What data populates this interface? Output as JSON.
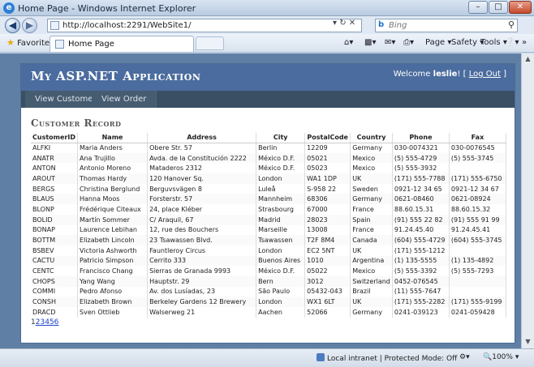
{
  "window": {
    "title": "Home Page - Windows Internet Explorer"
  },
  "address": {
    "url": "http://localhost:2291/WebSite1/",
    "search_placeholder": "Bing"
  },
  "favorites": {
    "label": "Favorites"
  },
  "tab": {
    "label": "Home Page"
  },
  "commands": {
    "page": "Page",
    "safety": "Safety",
    "tools": "Tools"
  },
  "site": {
    "title": "My ASP.NET Application",
    "welcome": "Welcome",
    "user": "leslie",
    "bang": "! [",
    "logout": "Log Out",
    "close_bracket": "]",
    "menu": [
      "View Customer",
      "View Order"
    ]
  },
  "section": {
    "title": "Customer Record"
  },
  "table": {
    "columns": [
      "CustomerID",
      "Name",
      "Address",
      "City",
      "PostalCode",
      "Country",
      "Phone",
      "Fax"
    ],
    "rows": [
      [
        "ALFKI",
        "Maria Anders",
        "Obere Str. 57",
        "Berlin",
        "12209",
        "Germany",
        "030-0074321",
        "030-0076545"
      ],
      [
        "ANATR",
        "Ana Trujillo",
        "Avda. de la Constitución 2222",
        "México D.F.",
        "05021",
        "Mexico",
        "(5) 555-4729",
        "(5) 555-3745"
      ],
      [
        "ANTON",
        "Antonio Moreno",
        "Mataderos 2312",
        "México D.F.",
        "05023",
        "Mexico",
        "(5) 555-3932",
        ""
      ],
      [
        "AROUT",
        "Thomas Hardy",
        "120 Hanover Sq.",
        "London",
        "WA1 1DP",
        "UK",
        "(171) 555-7788",
        "(171) 555-6750"
      ],
      [
        "BERGS",
        "Christina Berglund",
        "Berguvsvägen 8",
        "Luleå",
        "S-958 22",
        "Sweden",
        "0921-12 34 65",
        "0921-12 34 67"
      ],
      [
        "BLAUS",
        "Hanna Moos",
        "Forsterstr. 57",
        "Mannheim",
        "68306",
        "Germany",
        "0621-08460",
        "0621-08924"
      ],
      [
        "BLONP",
        "Frédérique Citeaux",
        "24, place Kléber",
        "Strasbourg",
        "67000",
        "France",
        "88.60.15.31",
        "88.60.15.32"
      ],
      [
        "BOLID",
        "Martín Sommer",
        "C/ Araquil, 67",
        "Madrid",
        "28023",
        "Spain",
        "(91) 555 22 82",
        "(91) 555 91 99"
      ],
      [
        "BONAP",
        "Laurence Lebihan",
        "12, rue des Bouchers",
        "Marseille",
        "13008",
        "France",
        "91.24.45.40",
        "91.24.45.41"
      ],
      [
        "BOTTM",
        "Elizabeth Lincoln",
        "23 Tsawassen Blvd.",
        "Tsawassen",
        "T2F 8M4",
        "Canada",
        "(604) 555-4729",
        "(604) 555-3745"
      ],
      [
        "BSBEV",
        "Victoria Ashworth",
        "Fauntleroy Circus",
        "London",
        "EC2 5NT",
        "UK",
        "(171) 555-1212",
        ""
      ],
      [
        "CACTU",
        "Patricio Simpson",
        "Cerrito 333",
        "Buenos Aires",
        "1010",
        "Argentina",
        "(1) 135-5555",
        "(1) 135-4892"
      ],
      [
        "CENTC",
        "Francisco Chang",
        "Sierras de Granada 9993",
        "México D.F.",
        "05022",
        "Mexico",
        "(5) 555-3392",
        "(5) 555-7293"
      ],
      [
        "CHOPS",
        "Yang Wang",
        "Hauptstr. 29",
        "Bern",
        "3012",
        "Switzerland",
        "0452-076545",
        ""
      ],
      [
        "COMMI",
        "Pedro Afonso",
        "Av. dos Lusíadas, 23",
        "São Paulo",
        "05432-043",
        "Brazil",
        "(11) 555-7647",
        ""
      ],
      [
        "CONSH",
        "Elizabeth Brown",
        "Berkeley Gardens 12 Brewery",
        "London",
        "WX1 6LT",
        "UK",
        "(171) 555-2282",
        "(171) 555-9199"
      ],
      [
        "DRACD",
        "Sven Ottlieb",
        "Walserweg 21",
        "Aachen",
        "52066",
        "Germany",
        "0241-039123",
        "0241-059428"
      ]
    ]
  },
  "pager": {
    "current": "1",
    "pages": [
      "2",
      "3",
      "4",
      "5",
      "6"
    ]
  },
  "status": {
    "zone": "Local intranet | Protected Mode: Off",
    "zoom": "100%"
  }
}
